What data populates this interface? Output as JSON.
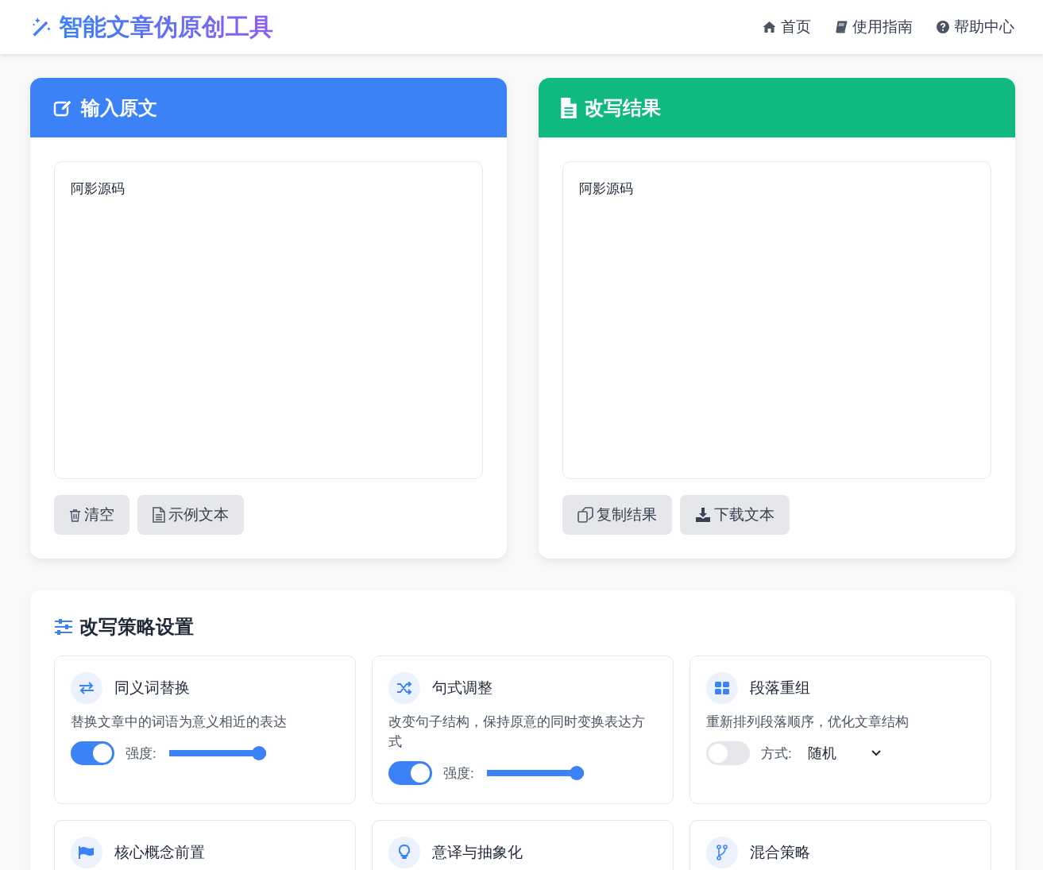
{
  "header": {
    "title": "智能文章伪原创工具",
    "nav": [
      {
        "label": "首页"
      },
      {
        "label": "使用指南"
      },
      {
        "label": "帮助中心"
      }
    ]
  },
  "panels": [
    {
      "title": "输入原文",
      "kind": "input",
      "text": "阿影源码",
      "buttons": [
        "清空",
        "示例文本"
      ]
    },
    {
      "title": "改写结果",
      "kind": "output",
      "text": "阿影源码",
      "buttons": [
        "复制结果",
        "下载文本"
      ]
    }
  ],
  "strategies": {
    "title": "改写策略设置",
    "items": [
      {
        "title": "同义词替换",
        "description": "替换文章中的词语为意义相近的表达",
        "kind": "slider",
        "on": true,
        "label": "强度:",
        "level": 1
      },
      {
        "title": "句式调整",
        "description": "改变句子结构，保持原意的同时变换表达方式",
        "kind": "slider",
        "on": true,
        "label": "强度:",
        "level": 1
      },
      {
        "title": "段落重组",
        "description": "重新排列段落顺序，优化文章结构",
        "kind": "select",
        "on": false,
        "label": "方式:",
        "value": "随机"
      },
      {
        "title": "核心概念前置"
      },
      {
        "title": "意译与抽象化"
      },
      {
        "title": "混合策略"
      }
    ]
  }
}
